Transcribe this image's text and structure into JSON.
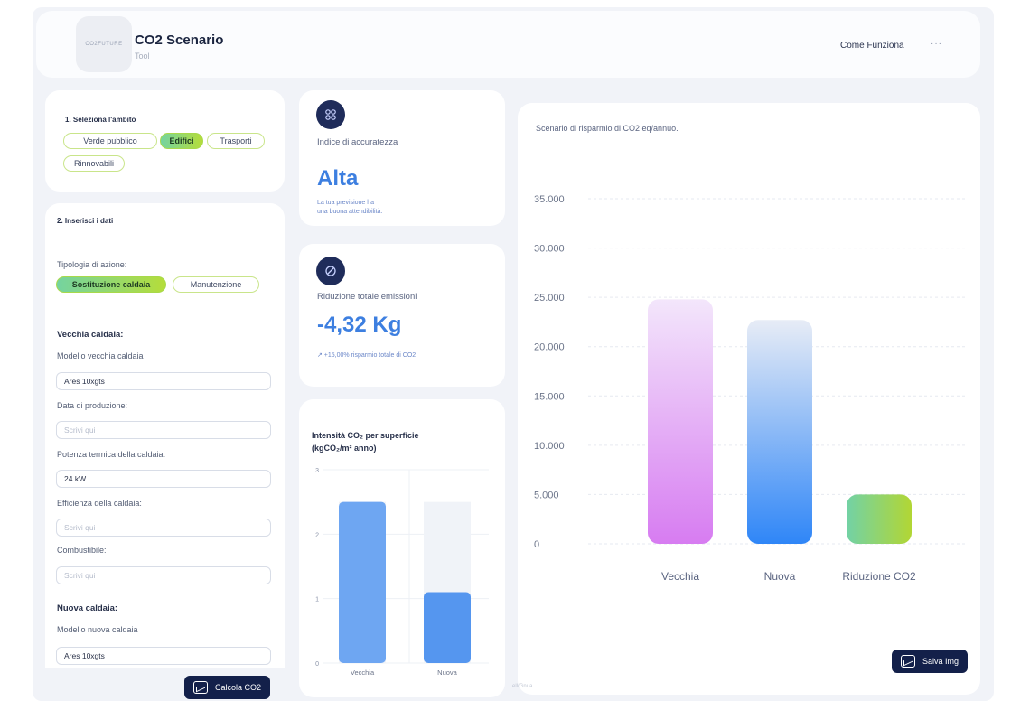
{
  "header": {
    "logo_text": "CO2FUTURE",
    "title": "CO2 Scenario",
    "subtitle": "Tool",
    "how_link": "Come Funziona",
    "more": "···"
  },
  "ambito": {
    "title": "1. Seleziona l'ambito",
    "chips": [
      "Verde pubblico",
      "Edifici",
      "Trasporti",
      "Rinnovabili"
    ],
    "selected": "Edifici"
  },
  "dati": {
    "title": "2. Inserisci i dati",
    "tipologia_label": "Tipologia di azione:",
    "tipologia_chips": [
      "Sostituzione caldaia",
      "Manutenzione"
    ],
    "tipologia_selected": "Sostituzione caldaia",
    "vecchia_heading": "Vecchia caldaia:",
    "modello_vecchia_label": "Modello vecchia caldaia",
    "modello_vecchia_value": "Ares 10xgts",
    "data_label": "Data di produzione:",
    "data_placeholder": "Scrivi qui",
    "potenza_label": "Potenza termica della caldaia:",
    "potenza_value": "24 kW",
    "efficienza_label": "Efficienza della caldaia:",
    "efficienza_placeholder": "Scrivi qui",
    "combustibile_label": "Combustibile:",
    "combustibile_placeholder": "Scrivi qui",
    "nuova_heading": "Nuova caldaia:",
    "modello_nuova_label": "Modello nuova caldaia",
    "modello_nuova_value": "Ares 10xgts",
    "calcola_label": "Calcola CO2"
  },
  "accuratezza": {
    "icon": "gauge-icon",
    "label": "Indice di accuratezza",
    "value": "Alta",
    "note_line1": "La tua previsione ha",
    "note_line2": "una buona attendibilità."
  },
  "riduzione": {
    "icon": "leaf-icon",
    "label": "Riduzione totale emissioni",
    "value": "-4,32 Kg",
    "note": "↗ +15,00% risparmio totale di CO2"
  },
  "intensita": {
    "title_line1": "Intensità CO₂ per superficie",
    "title_line2": "(kgCO₂/m² anno)"
  },
  "scenario": {
    "title": "Scenario di risparmio di CO2 eq/annuo.",
    "save_label": "Salva Img",
    "footer_text": "ell/Gnua"
  },
  "chart_data": [
    {
      "type": "bar",
      "title": "Intensità CO₂ per superficie (kgCO₂/m² anno)",
      "categories": [
        "Vecchia",
        "Nuova"
      ],
      "values": [
        2.5,
        1.1
      ],
      "background_values": [
        2.5,
        2.5
      ],
      "ylim": [
        0,
        3
      ],
      "yticks": [
        0,
        1,
        2,
        3
      ],
      "grid": true,
      "colors": [
        "#6ea6f2",
        "#5596ef"
      ]
    },
    {
      "type": "bar",
      "title": "Scenario di risparmio di CO2 eq/annuo.",
      "categories": [
        "Vecchia",
        "Nuova",
        "Riduzione CO2"
      ],
      "values": [
        24800,
        22700,
        5000
      ],
      "ylim": [
        0,
        35000
      ],
      "yticks": [
        "0",
        "5.000",
        "10.000",
        "15.000",
        "20.000",
        "25.000",
        "30.000",
        "35.000"
      ],
      "grid": true,
      "gradients": [
        [
          "#f3e6fb",
          "#d77cf1"
        ],
        [
          "#e7ecf6",
          "#2f86f7"
        ],
        [
          "#72d2a6",
          "#b2d634"
        ]
      ]
    }
  ]
}
